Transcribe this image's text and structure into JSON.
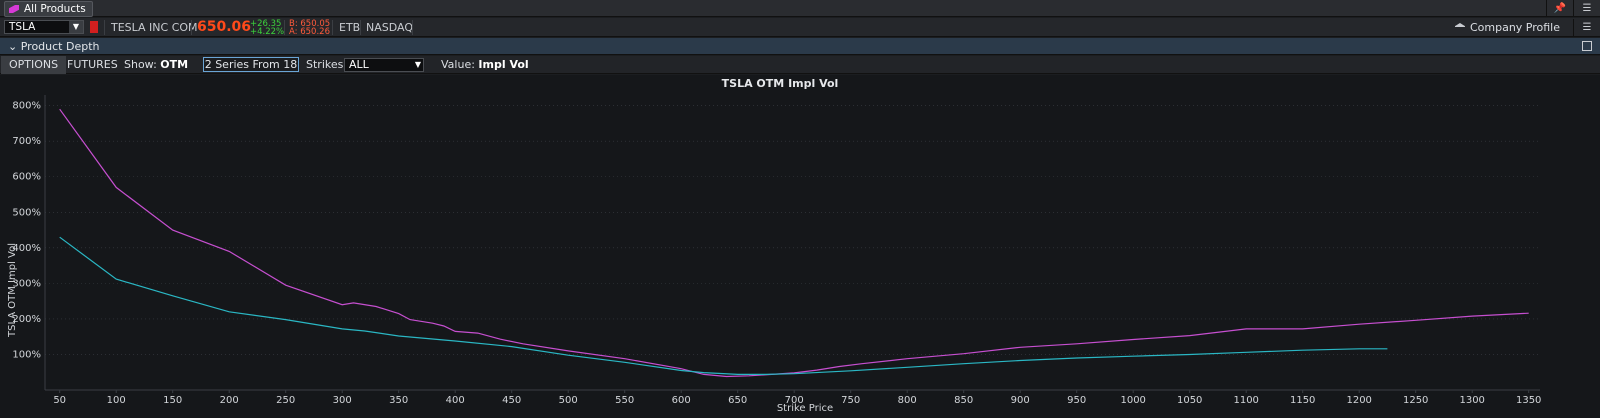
{
  "topbar": {
    "all_products": "All Products",
    "pin": "📌",
    "menu": "☰"
  },
  "quote": {
    "symbol": "TSLA",
    "name": "TESLA INC COM",
    "last": "650.06",
    "change": "+26.35",
    "change_pct": "+4.22%",
    "bid": "B: 650.05",
    "ask": "A: 650.26",
    "etb": "ETB",
    "exchange": "NASDAQ",
    "company_profile": "Company Profile"
  },
  "section": {
    "title": "Product Depth"
  },
  "controls": {
    "tab_options": "OPTIONS",
    "tab_futures": "FUTURES",
    "show_label": "Show:",
    "show_value": "OTM",
    "series": "2 Series From 18",
    "strikes_label": "Strikes:",
    "strikes_value": "ALL",
    "value_label": "Value:",
    "value_value": "Impl Vol"
  },
  "colors": {
    "series1": "#c64fd0",
    "series2": "#2ab7c4",
    "background": "#15171a",
    "grid": "#3a3e44"
  },
  "chart_data": {
    "type": "line",
    "title": "TSLA OTM Impl Vol",
    "xlabel": "Strike Price",
    "ylabel": "TSLA OTM Impl Vol",
    "xlim": [
      37,
      1360
    ],
    "ylim": [
      0,
      830
    ],
    "x_ticks": [
      50,
      100,
      150,
      200,
      250,
      300,
      350,
      400,
      450,
      500,
      550,
      600,
      650,
      700,
      750,
      800,
      850,
      900,
      950,
      1000,
      1050,
      1100,
      1150,
      1200,
      1250,
      1300,
      1350
    ],
    "y_ticks": [
      100,
      200,
      300,
      400,
      500,
      600,
      700,
      800
    ],
    "y_tick_labels": [
      "100%",
      "200%",
      "300%",
      "400%",
      "500%",
      "600%",
      "700%",
      "800%"
    ],
    "grid": true,
    "legend": "none",
    "series": [
      {
        "color": "#c64fd0",
        "points": [
          [
            50,
            790
          ],
          [
            100,
            570
          ],
          [
            150,
            450
          ],
          [
            200,
            390
          ],
          [
            250,
            295
          ],
          [
            300,
            240
          ],
          [
            310,
            245
          ],
          [
            330,
            235
          ],
          [
            350,
            215
          ],
          [
            360,
            198
          ],
          [
            380,
            188
          ],
          [
            390,
            180
          ],
          [
            400,
            165
          ],
          [
            420,
            160
          ],
          [
            440,
            143
          ],
          [
            460,
            130
          ],
          [
            500,
            110
          ],
          [
            550,
            88
          ],
          [
            600,
            60
          ],
          [
            620,
            44
          ],
          [
            640,
            38
          ],
          [
            660,
            40
          ],
          [
            680,
            44
          ],
          [
            700,
            48
          ],
          [
            720,
            56
          ],
          [
            740,
            66
          ],
          [
            760,
            74
          ],
          [
            800,
            88
          ],
          [
            850,
            102
          ],
          [
            900,
            120
          ],
          [
            950,
            130
          ],
          [
            1000,
            142
          ],
          [
            1050,
            153
          ],
          [
            1100,
            172
          ],
          [
            1150,
            172
          ],
          [
            1200,
            185
          ],
          [
            1250,
            196
          ],
          [
            1300,
            208
          ],
          [
            1350,
            216
          ]
        ]
      },
      {
        "color": "#2ab7c4",
        "points": [
          [
            50,
            430
          ],
          [
            100,
            312
          ],
          [
            150,
            265
          ],
          [
            200,
            220
          ],
          [
            250,
            198
          ],
          [
            300,
            172
          ],
          [
            320,
            166
          ],
          [
            350,
            152
          ],
          [
            400,
            138
          ],
          [
            450,
            122
          ],
          [
            500,
            98
          ],
          [
            550,
            78
          ],
          [
            600,
            55
          ],
          [
            620,
            49
          ],
          [
            650,
            44
          ],
          [
            675,
            44
          ],
          [
            700,
            46
          ],
          [
            750,
            54
          ],
          [
            800,
            64
          ],
          [
            850,
            74
          ],
          [
            900,
            83
          ],
          [
            950,
            90
          ],
          [
            1000,
            95
          ],
          [
            1050,
            100
          ],
          [
            1100,
            106
          ],
          [
            1150,
            112
          ],
          [
            1200,
            116
          ],
          [
            1225,
            116
          ]
        ]
      }
    ]
  }
}
